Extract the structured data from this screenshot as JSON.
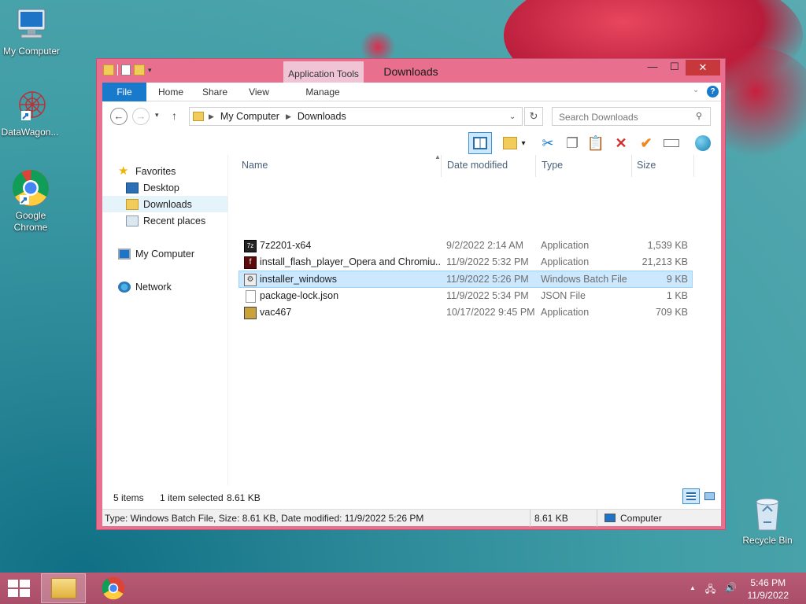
{
  "desktop": {
    "icons": [
      {
        "label": "My Computer",
        "icon": "computer-icon"
      },
      {
        "label": "DataWagon...",
        "icon": "datawagon-icon"
      },
      {
        "label": "Google Chrome",
        "icon": "chrome-icon"
      },
      {
        "label": "Recycle Bin",
        "icon": "recycle-bin-icon"
      }
    ]
  },
  "window": {
    "title": "Downloads",
    "context_tab": "Application Tools",
    "ribbon_tabs": [
      "File",
      "Home",
      "Share",
      "View",
      "Manage"
    ],
    "controls": {
      "minimize": "—",
      "maximize": "☐",
      "close": "✕"
    },
    "address": {
      "segments": [
        "My Computer",
        "Downloads"
      ]
    },
    "search_placeholder": "Search Downloads",
    "nav": {
      "favorites": "Favorites",
      "desktop": "Desktop",
      "downloads": "Downloads",
      "recent": "Recent places",
      "computer": "My Computer",
      "network": "Network"
    },
    "columns": [
      "Name",
      "Date modified",
      "Type",
      "Size"
    ],
    "files": [
      {
        "name": "7z2201-x64",
        "date": "9/2/2022 2:14 AM",
        "type": "Application",
        "size": "1,539 KB",
        "icon": "7zip-icon"
      },
      {
        "name": "install_flash_player_Opera and Chromiu...",
        "date": "11/9/2022 5:32 PM",
        "type": "Application",
        "size": "21,213 KB",
        "icon": "flash-icon"
      },
      {
        "name": "installer_windows",
        "date": "11/9/2022 5:26 PM",
        "type": "Windows Batch File",
        "size": "9 KB",
        "icon": "batch-file-icon"
      },
      {
        "name": "package-lock.json",
        "date": "11/9/2022 5:34 PM",
        "type": "JSON File",
        "size": "1 KB",
        "icon": "json-file-icon"
      },
      {
        "name": "vac467",
        "date": "10/17/2022 9:45 PM",
        "type": "Application",
        "size": "709 KB",
        "icon": "vac-app-icon"
      }
    ],
    "status": {
      "items": "5 items",
      "selected": "1 item selected",
      "selected_size": "8.61 KB"
    },
    "statusbar": {
      "details": "Type: Windows Batch File, Size: 8.61 KB, Date modified: 11/9/2022 5:26 PM",
      "size": "8.61 KB",
      "location": "Computer"
    }
  },
  "taskbar": {
    "time": "5:46 PM",
    "date": "11/9/2022"
  },
  "colors": {
    "window_frame": "#e8708e",
    "file_tab": "#1979ca",
    "selection": "#cce8ff",
    "close_button": "#c7383c"
  }
}
